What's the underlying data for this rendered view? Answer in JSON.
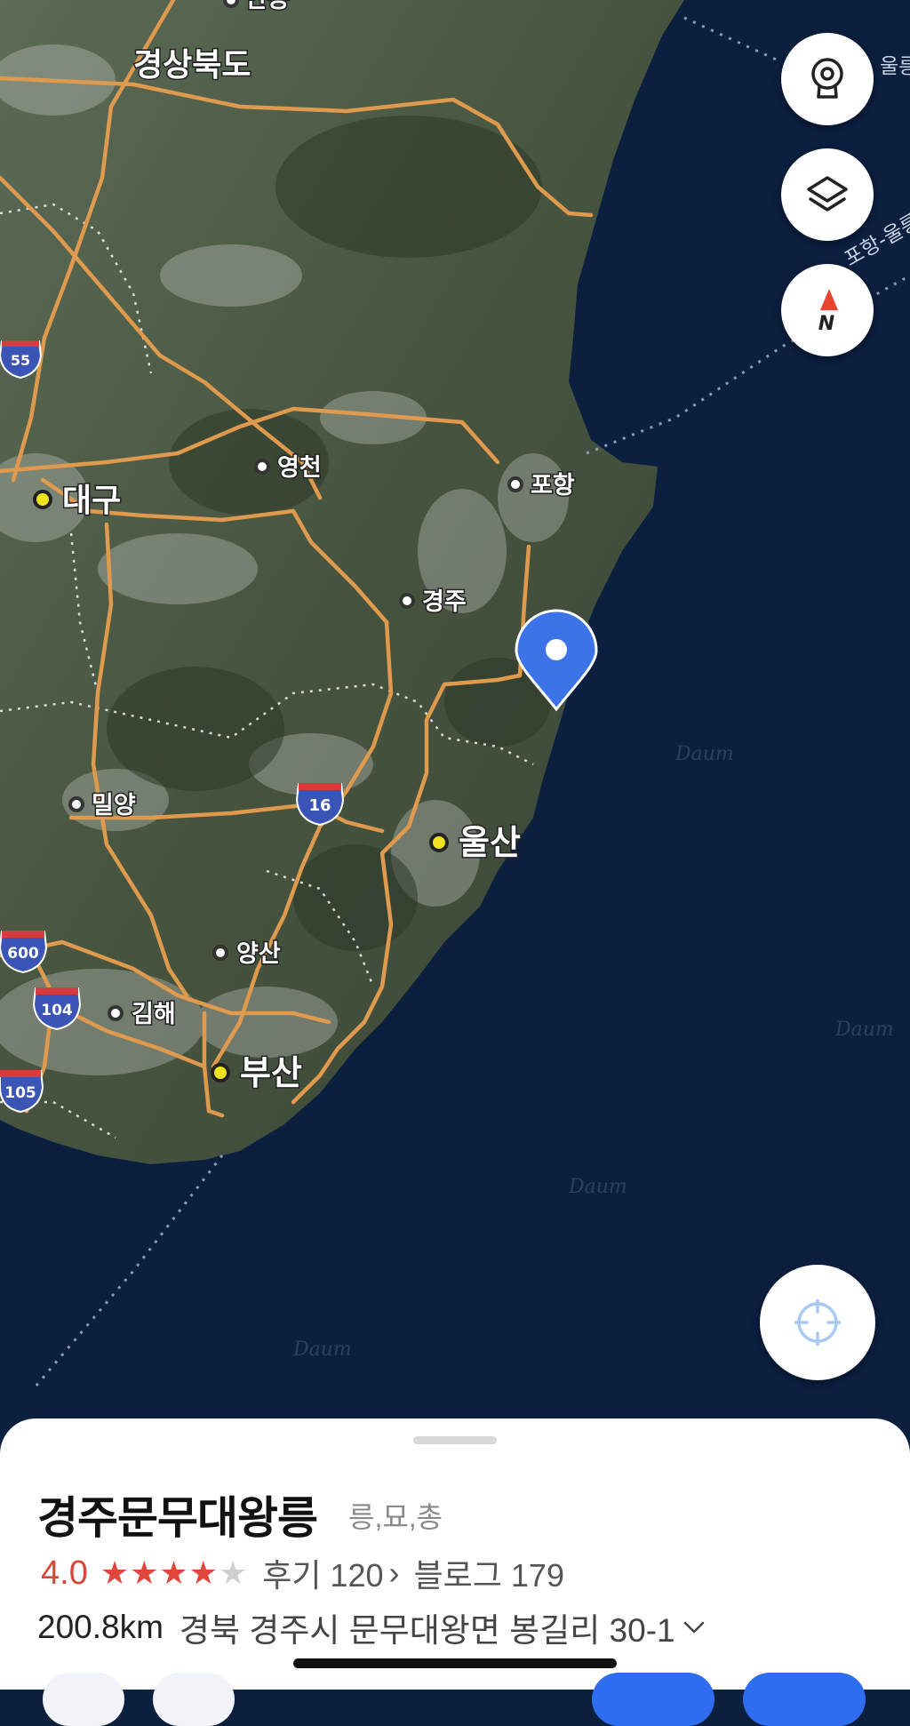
{
  "map": {
    "labels": {
      "province": "경상북도",
      "daegu": "대구",
      "yeongcheon": "영천",
      "pohang": "포항",
      "gyeongju": "경주",
      "miryang": "밀양",
      "ulsan": "울산",
      "yangsan": "양산",
      "gimhae": "김해",
      "busan": "부산",
      "top_cut": "안동",
      "route_label": "포항-울릉",
      "edge_label": "울릉"
    },
    "highway_shields": [
      "55",
      "16",
      "600",
      "104",
      "105"
    ],
    "watermark": "Daum",
    "colors": {
      "road": "#e09a4e",
      "pin": "#3d73e8",
      "sea": "#0b1f3f",
      "rating": "#d9463a"
    }
  },
  "controls": {
    "streetview_icon": "streetview-icon",
    "layers_icon": "layers-icon",
    "compass_icon": "compass-icon",
    "compass_letter": "N",
    "my_location_icon": "crosshair-icon"
  },
  "place": {
    "title": "경주문무대왕릉",
    "category": "릉,묘,총",
    "rating": "4.0",
    "stars": 4,
    "stars_max": 5,
    "reviews_text": "후기 120",
    "blog_text": "블로그 179",
    "distance": "200.8km",
    "address": "경북 경주시 문무대왕면 봉길리 30-1"
  }
}
